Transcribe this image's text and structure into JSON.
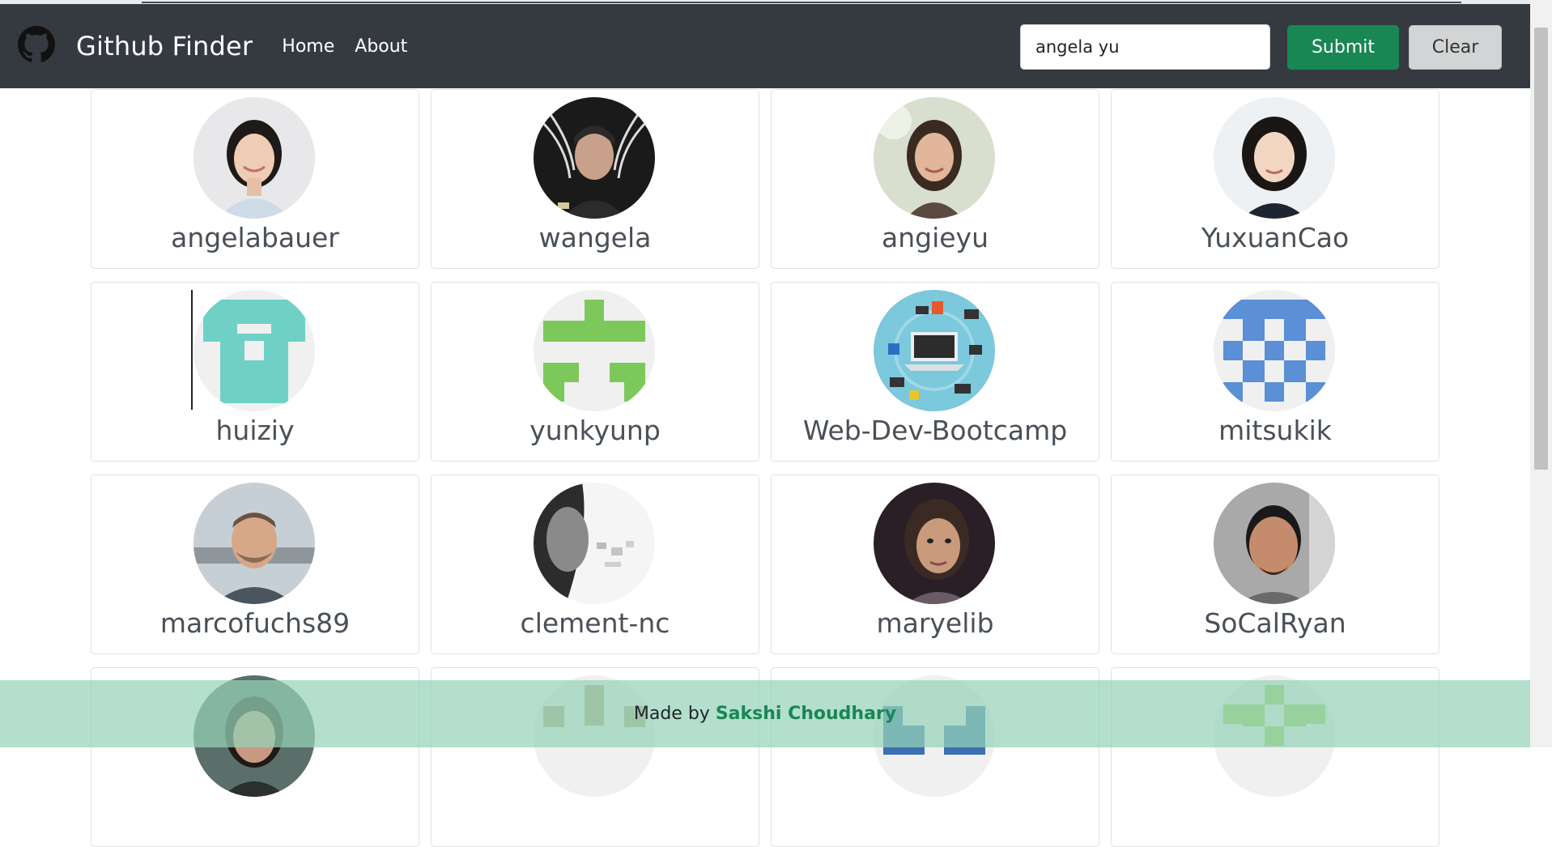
{
  "navbar": {
    "brand": "Github Finder",
    "links": [
      "Home",
      "About"
    ],
    "search_value": "angela yu",
    "submit_label": "Submit",
    "clear_label": "Clear"
  },
  "users": [
    {
      "login": "angelabauer"
    },
    {
      "login": "wangela"
    },
    {
      "login": "angieyu"
    },
    {
      "login": "YuxuanCao"
    },
    {
      "login": "huiziy"
    },
    {
      "login": "yunkyunp"
    },
    {
      "login": "Web-Dev-Bootcamp"
    },
    {
      "login": "mitsukik"
    },
    {
      "login": "marcofuchs89"
    },
    {
      "login": "clement-nc"
    },
    {
      "login": "maryelib"
    },
    {
      "login": "SoCalRyan"
    }
  ],
  "footer": {
    "prefix": "Made by ",
    "author": "Sakshi Choudhary"
  },
  "colors": {
    "navbar_bg": "#343a40",
    "submit_bg": "#198754",
    "footer_bg": "#b5e0cf",
    "author_color": "#198754"
  }
}
